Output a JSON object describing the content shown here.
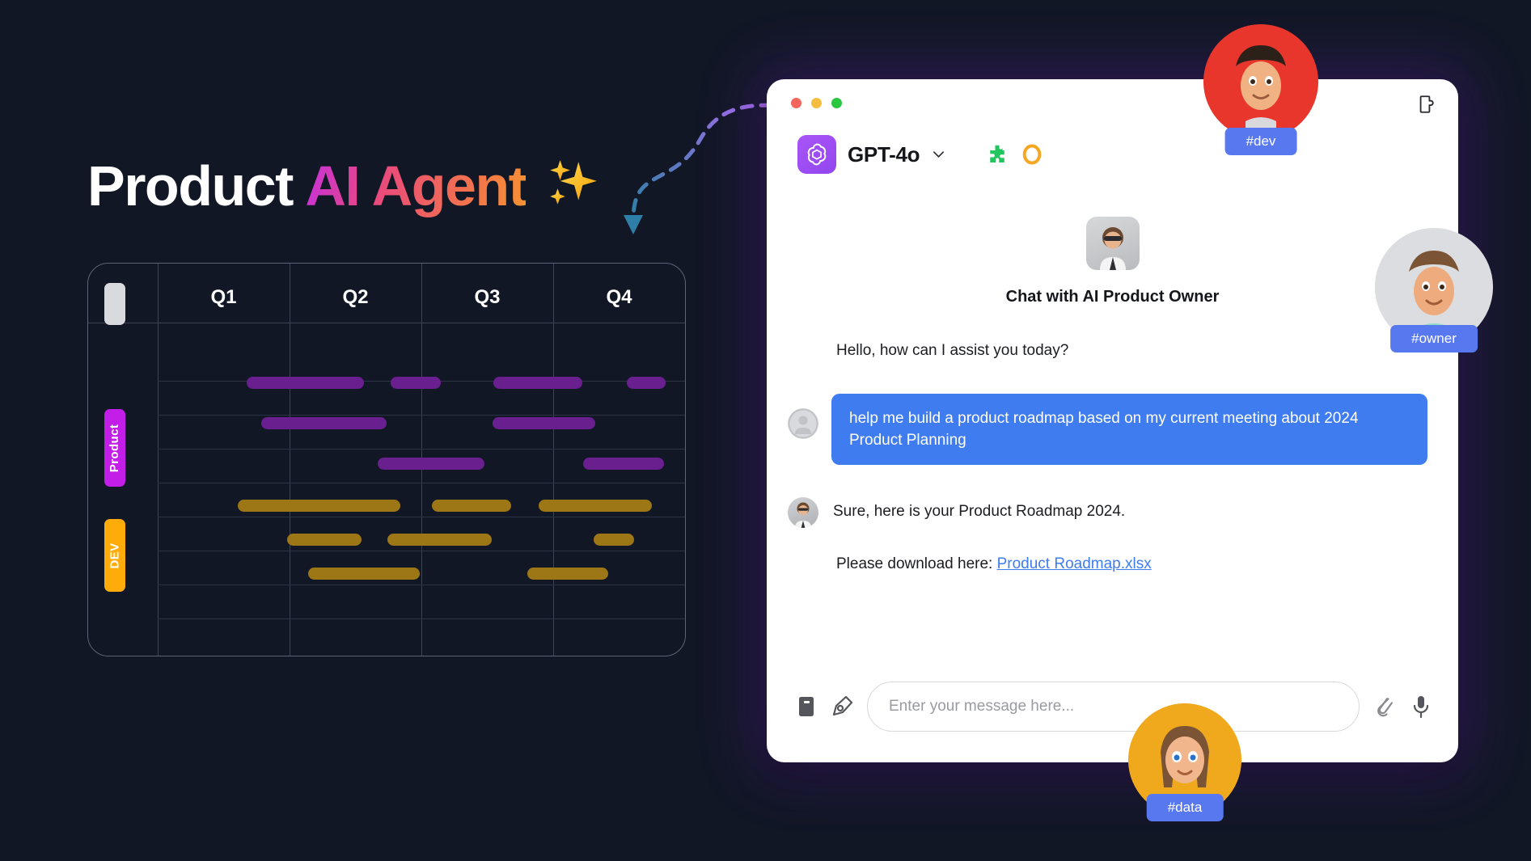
{
  "hero": {
    "text_white": "Product",
    "text_gradient": "AI Agent",
    "sparkle_icon": "sparkles-icon",
    "gradient_from": "#c531e0",
    "gradient_to": "#f59331"
  },
  "gantt": {
    "corner_tag_label": "",
    "columns": [
      "Q1",
      "Q2",
      "Q3",
      "Q4"
    ],
    "row_groups": [
      {
        "label": "Product",
        "color": "#c21ee8",
        "bar_color": "#6a1f8f"
      },
      {
        "label": "DEV",
        "color": "#ffab09",
        "bar_color": "#9d7615"
      }
    ],
    "bars": [
      {
        "group": "Product",
        "row": 0,
        "left_pct": 15.5,
        "width_pct": 26.0
      },
      {
        "group": "Product",
        "row": 0,
        "left_pct": 46.8,
        "width_pct": 10.8
      },
      {
        "group": "Product",
        "row": 0,
        "left_pct": 68.5,
        "width_pct": 19.2
      },
      {
        "group": "Product",
        "row": 0,
        "left_pct": 92.0,
        "width_pct": 8.0
      },
      {
        "group": "Product",
        "row": 1,
        "left_pct": 18.4,
        "width_pct": 27.1
      },
      {
        "group": "Product",
        "row": 1,
        "left_pct": 68.0,
        "width_pct": 22.5
      },
      {
        "group": "Product",
        "row": 2,
        "left_pct": 41.0,
        "width_pct": 23.2
      },
      {
        "group": "Product",
        "row": 2,
        "left_pct": 82.5,
        "width_pct": 17.5
      },
      {
        "group": "DEV",
        "row": 0,
        "left_pct": 13.6,
        "width_pct": 35.2
      },
      {
        "group": "DEV",
        "row": 0,
        "left_pct": 54.0,
        "width_pct": 17.0
      },
      {
        "group": "DEV",
        "row": 0,
        "left_pct": 76.8,
        "width_pct": 24.5
      },
      {
        "group": "DEV",
        "row": 1,
        "left_pct": 24.0,
        "width_pct": 16.0
      },
      {
        "group": "DEV",
        "row": 1,
        "left_pct": 44.0,
        "width_pct": 22.5
      },
      {
        "group": "DEV",
        "row": 1,
        "left_pct": 85.0,
        "width_pct": 8.5
      },
      {
        "group": "DEV",
        "row": 2,
        "left_pct": 28.5,
        "width_pct": 24.0
      },
      {
        "group": "DEV",
        "row": 2,
        "left_pct": 70.5,
        "width_pct": 17.5
      }
    ]
  },
  "connector": {
    "name": "dashed-arrow",
    "color_start": "#b06df0",
    "color_end": "#2e7fa8"
  },
  "chat": {
    "window_controls": [
      "close",
      "minimize",
      "maximize"
    ],
    "plugin_icon": "puzzle-outline-icon",
    "model": {
      "logo_icon": "openai-logo-icon",
      "name": "GPT-4o",
      "chevron_icon": "chevron-down-icon"
    },
    "header_icons": [
      {
        "name": "puzzle-icon",
        "color": "#22c55e"
      },
      {
        "name": "eye-icon",
        "color": "#f5a623"
      }
    ],
    "intro": {
      "avatar_icon": "product-owner-avatar",
      "title": "Chat with AI Product Owner"
    },
    "messages": [
      {
        "id": "greeting",
        "role": "assistant-plain",
        "text": "Hello, how can I assist you today?"
      },
      {
        "id": "user-request",
        "role": "user",
        "avatar_icon": "user-avatar-icon",
        "text": "help me build a product roadmap based on my current meeting about 2024 Product Planning"
      },
      {
        "id": "assistant-reply",
        "role": "assistant",
        "avatar_icon": "assistant-avatar",
        "text": "Sure, here is your Product Roadmap 2024."
      }
    ],
    "download": {
      "prefix": "Please download here:",
      "link_label": "Product Roadmap.xlsx"
    },
    "input": {
      "placeholder": "Enter your message here...",
      "value": "",
      "left_icons": [
        {
          "name": "book-icon"
        },
        {
          "name": "pen-nib-icon"
        }
      ],
      "right_icons": [
        {
          "name": "paperclip-icon"
        },
        {
          "name": "microphone-icon"
        }
      ]
    },
    "accent_color": "#3f7cf0"
  },
  "floating_avatars": [
    {
      "name": "avatar-dev",
      "badge": "#dev",
      "bg": "#e8362c"
    },
    {
      "name": "avatar-owner",
      "badge": "#owner",
      "bg": "#dfe0e3"
    },
    {
      "name": "avatar-data",
      "badge": "#data",
      "bg": "#f0a81c"
    }
  ]
}
